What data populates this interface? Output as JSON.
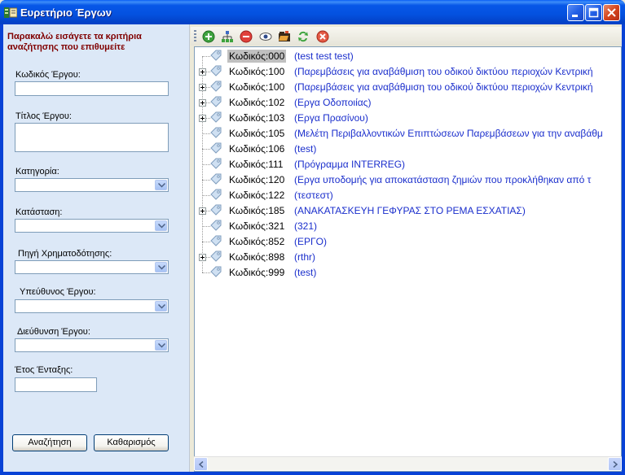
{
  "window": {
    "title": "Ευρετήριο Έργων"
  },
  "search_form": {
    "instructions": "Παρακαλώ εισάγετε τα κριτήρια αναζήτησης που επιθυμείτε",
    "fields": {
      "project_code": {
        "label": "Κωδικός Έργου:",
        "value": ""
      },
      "project_title": {
        "label": "Τίτλος Έργου:",
        "value": ""
      },
      "category": {
        "label": "Κατηγορία:",
        "value": ""
      },
      "status": {
        "label": "Κατάσταση:",
        "value": ""
      },
      "funding_source": {
        "label": "Πηγή Χρηματοδότησης:",
        "value": ""
      },
      "project_manager": {
        "label": "Υπεύθυνος Έργου:",
        "value": ""
      },
      "project_directorate": {
        "label": "Διεύθυνση Έργου:",
        "value": ""
      },
      "inclusion_year": {
        "label": "Έτος Ένταξης:",
        "value": ""
      }
    },
    "buttons": {
      "search": "Αναζήτηση",
      "clear": "Καθαρισμός"
    }
  },
  "toolbar": {
    "icons": [
      "add-icon",
      "hierarchy-icon",
      "delete-icon",
      "view-icon",
      "open-folder-icon",
      "refresh-icon",
      "cancel-icon"
    ]
  },
  "tree": {
    "nodes": [
      {
        "code": "Κωδικός:000",
        "description": "(test test test)",
        "expandable": false,
        "selected": true
      },
      {
        "code": "Κωδικός:100",
        "description": "(Παρεμβάσεις για αναβάθμιση του οδικού δικτύου περιοχών Κεντρική",
        "expandable": true,
        "selected": false
      },
      {
        "code": "Κωδικός:100",
        "description": "(Παρεμβάσεις για αναβάθμιση του οδικού δικτύου περιοχών Κεντρική",
        "expandable": true,
        "selected": false
      },
      {
        "code": "Κωδικός:102",
        "description": "(Εργα Οδοποιίας)",
        "expandable": true,
        "selected": false
      },
      {
        "code": "Κωδικός:103",
        "description": "(Εργα Πρασίνου)",
        "expandable": true,
        "selected": false
      },
      {
        "code": "Κωδικός:105",
        "description": "(Μελέτη Περιβαλλοντικών Επιπτώσεων Παρεμβάσεων για την αναβάθμ",
        "expandable": false,
        "selected": false
      },
      {
        "code": "Κωδικός:106",
        "description": "(test)",
        "expandable": false,
        "selected": false
      },
      {
        "code": "Κωδικός:111",
        "description": "(Πρόγραμμα INTERREG)",
        "expandable": false,
        "selected": false
      },
      {
        "code": "Κωδικός:120",
        "description": "(Εργα υποδομής για αποκατάσταση ζημιών που προκλήθηκαν από τ",
        "expandable": false,
        "selected": false
      },
      {
        "code": "Κωδικός:122",
        "description": "(τεστεστ)",
        "expandable": false,
        "selected": false
      },
      {
        "code": "Κωδικός:185",
        "description": "(ΑΝΑΚΑΤΑΣΚΕΥΗ ΓΕΦΥΡΑΣ ΣΤΟ ΡΕΜΑ ΕΣΧΑΤΙΑΣ)",
        "expandable": true,
        "selected": false
      },
      {
        "code": "Κωδικός:321",
        "description": "(321)",
        "expandable": false,
        "selected": false
      },
      {
        "code": "Κωδικός:852",
        "description": "(ΕΡΓΟ)",
        "expandable": false,
        "selected": false
      },
      {
        "code": "Κωδικός:898",
        "description": "(rthr)",
        "expandable": true,
        "selected": false
      },
      {
        "code": "Κωδικός:999",
        "description": "(test)",
        "expandable": false,
        "selected": false
      }
    ]
  }
}
